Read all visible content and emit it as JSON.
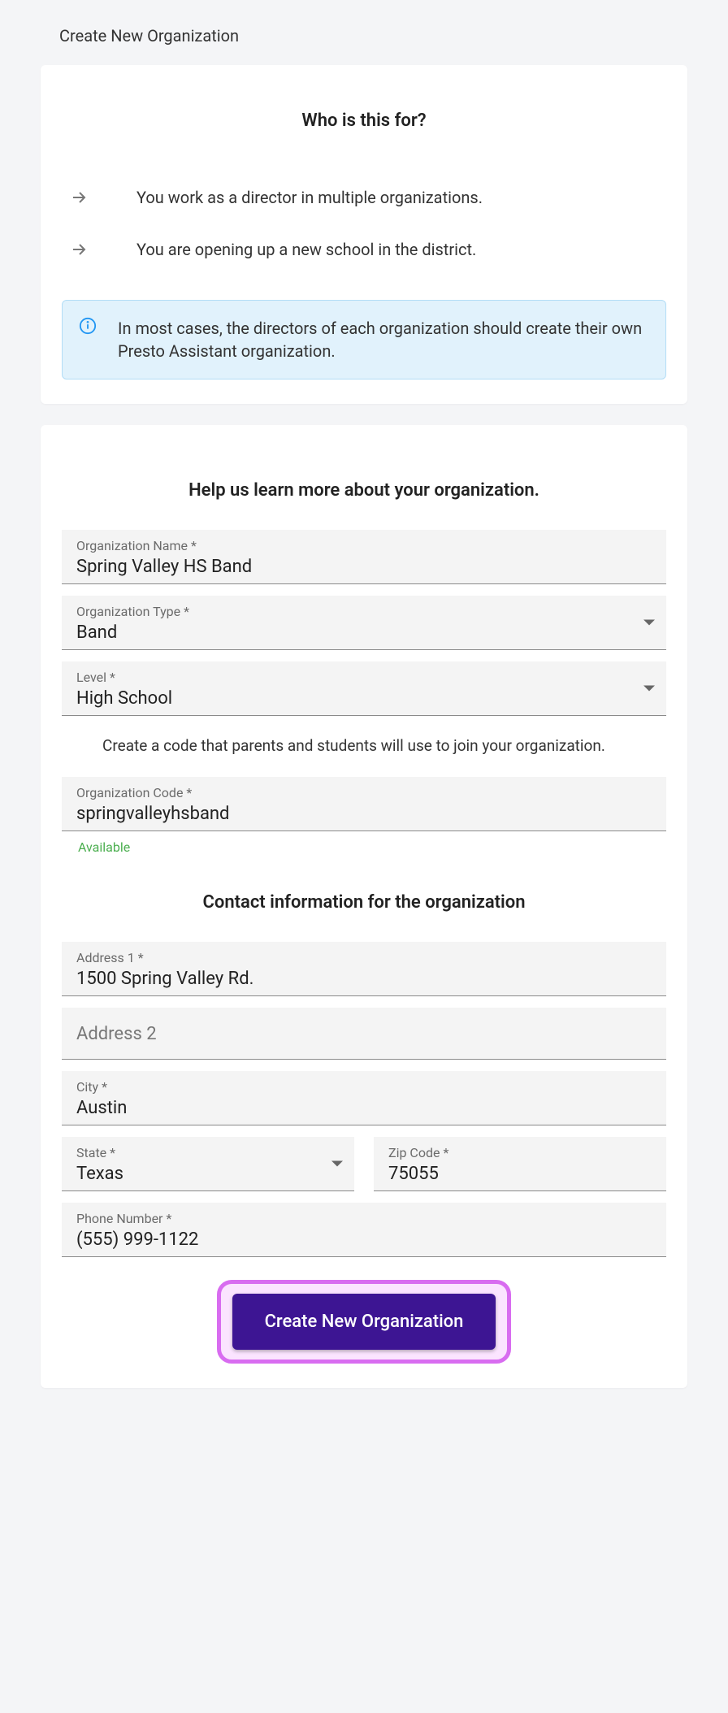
{
  "page": {
    "title": "Create New Organization"
  },
  "intro": {
    "heading": "Who is this for?",
    "bullets": [
      "You work as a director in multiple organizations.",
      "You are opening up a new school in the district."
    ],
    "info_text": "In most cases, the directors of each organization should create their own Presto Assistant organization."
  },
  "form": {
    "heading": "Help us learn more about your organization.",
    "fields": {
      "org_name": {
        "label": "Organization Name *",
        "value": "Spring Valley HS Band"
      },
      "org_type": {
        "label": "Organization Type *",
        "value": "Band"
      },
      "level": {
        "label": "Level *",
        "value": "High School"
      },
      "code_helper": "Create a code that parents and students will use to join your organization.",
      "org_code": {
        "label": "Organization Code *",
        "value": "springvalleyhsband",
        "status": "Available"
      },
      "contact_heading": "Contact information for the organization",
      "address1": {
        "label": "Address 1 *",
        "value": "1500 Spring Valley Rd."
      },
      "address2": {
        "placeholder": "Address 2",
        "value": ""
      },
      "city": {
        "label": "City *",
        "value": "Austin"
      },
      "state": {
        "label": "State *",
        "value": "Texas"
      },
      "zip": {
        "label": "Zip Code *",
        "value": "75055"
      },
      "phone": {
        "label": "Phone Number *",
        "value": "(555) 999-1122"
      }
    },
    "submit_label": "Create New Organization"
  }
}
